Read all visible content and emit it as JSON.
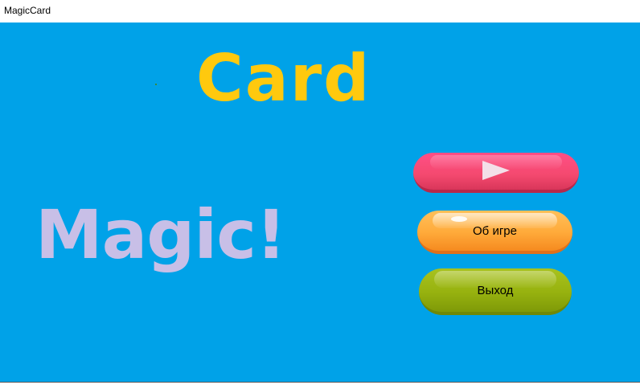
{
  "window": {
    "title": "MagicCard"
  },
  "logo": {
    "card_text": "Card",
    "magic_text": "Magic!"
  },
  "menu": {
    "play_icon": "play-icon",
    "about_label": "Об игре",
    "exit_label": "Выход"
  },
  "colors": {
    "background": "#00a2e8",
    "card_text": "#ffc90e",
    "magic_text": "#c8bfe7",
    "play_button": "#f4496f",
    "about_button": "#ffaa3a",
    "exit_button": "#97b20f"
  }
}
